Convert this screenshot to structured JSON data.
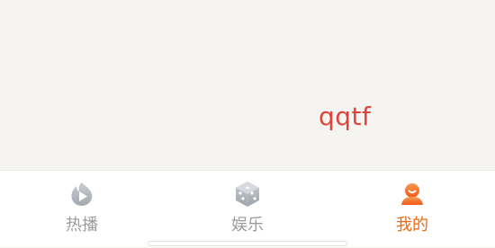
{
  "profile": {
    "username": "qqtf"
  },
  "tabbar": {
    "tabs": [
      {
        "label": "热播",
        "icon": "play-flame-icon",
        "active": false
      },
      {
        "label": "娱乐",
        "icon": "dice-icon",
        "active": false
      },
      {
        "label": "我的",
        "icon": "user-avatar-icon",
        "active": true
      }
    ],
    "active_color": "#ef6a13",
    "inactive_color": "#9c9c9c"
  },
  "accent": {
    "username_color": "#e0433b"
  }
}
